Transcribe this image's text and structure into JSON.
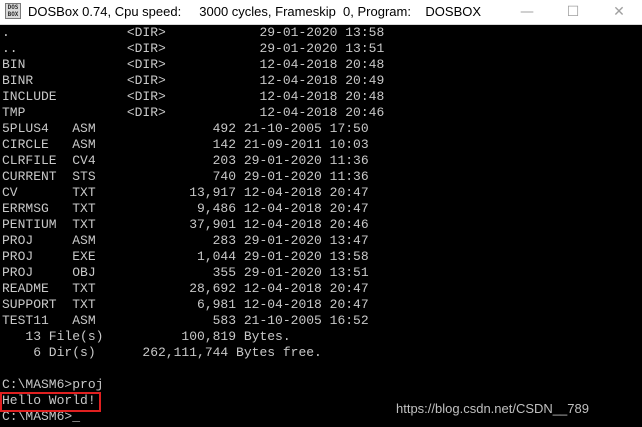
{
  "window": {
    "app_icon_text": "DOS BOX",
    "title": "DOSBox 0.74, Cpu speed:     3000 cycles, Frameskip  0, Program:    DOSBOX",
    "minimize_label": "—",
    "maximize_label": "☐",
    "close_label": "✕"
  },
  "console": {
    "lines": [
      ".               <DIR>            29-01-2020 13:58",
      "..              <DIR>            29-01-2020 13:51",
      "BIN             <DIR>            12-04-2018 20:48",
      "BINR            <DIR>            12-04-2018 20:49",
      "INCLUDE         <DIR>            12-04-2018 20:48",
      "TMP             <DIR>            12-04-2018 20:46",
      "5PLUS4   ASM               492 21-10-2005 17:50",
      "CIRCLE   ASM               142 21-09-2011 10:03",
      "CLRFILE  CV4               203 29-01-2020 11:36",
      "CURRENT  STS               740 29-01-2020 11:36",
      "CV       TXT            13,917 12-04-2018 20:47",
      "ERRMSG   TXT             9,486 12-04-2018 20:47",
      "PENTIUM  TXT            37,901 12-04-2018 20:46",
      "PROJ     ASM               283 29-01-2020 13:47",
      "PROJ     EXE             1,044 29-01-2020 13:58",
      "PROJ     OBJ               355 29-01-2020 13:51",
      "README   TXT            28,692 12-04-2018 20:47",
      "SUPPORT  TXT             6,981 12-04-2018 20:47",
      "TEST11   ASM               583 21-10-2005 16:52",
      "   13 File(s)          100,819 Bytes.",
      "    6 Dir(s)      262,111,744 Bytes free.",
      "",
      "",
      "C:\\MASM6>proj",
      "Hello World!",
      "C:\\MASM6>_"
    ]
  },
  "watermark": "https://blog.csdn.net/CSDN__789"
}
